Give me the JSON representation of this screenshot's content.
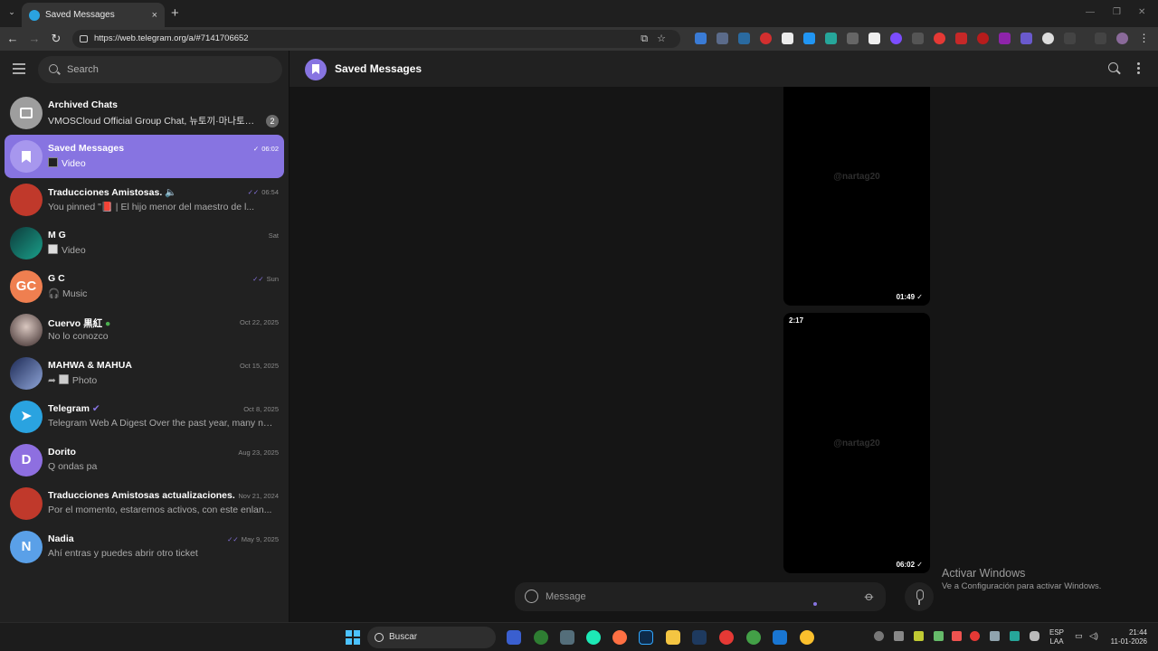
{
  "browser": {
    "tab_title": "Saved Messages",
    "tab_close": "×",
    "new_tab": "+",
    "url": "https://web.telegram.org/a/#7141706652"
  },
  "sidebar": {
    "search_placeholder": "Search",
    "chats": [
      {
        "name": "Archived Chats",
        "preview": "VMOSCloud Official Group Chat, 뉴토끼·마나토끼...",
        "time": "",
        "badge": "2",
        "avatar_text": "",
        "avatar_color": "#9e9e9e"
      },
      {
        "name": "Saved Messages",
        "preview": "Video",
        "time": "06:02",
        "avatar_text": "",
        "avatar_color": "#ffffff"
      },
      {
        "name": "Traducciones Amistosas.",
        "preview_prefix": "You:",
        "preview": "You pinned \"📕 | El hijo menor del maestro de l...",
        "time": "06:54",
        "avatar_text": "",
        "avatar_color": "#c0392b"
      },
      {
        "name": "M G",
        "preview": "Video",
        "time": "Sat",
        "avatar_text": "",
        "avatar_color": "#1a8a7a"
      },
      {
        "name": "G C",
        "preview": "🎧 Music",
        "time": "Sun",
        "avatar_text": "GC",
        "avatar_color": "#ef7f50"
      },
      {
        "name": "Cuervo 黒紅",
        "preview": "No lo conozco",
        "time": "Oct 22, 2025",
        "avatar_text": "",
        "avatar_color": "#5a4a4a"
      },
      {
        "name": "MAHWA & MAHUA",
        "preview": "Photo",
        "time": "Oct 15, 2025",
        "avatar_text": "",
        "avatar_color": "#3b4a7a"
      },
      {
        "name": "Telegram",
        "preview": "Telegram Web A Digest Over the past year, many ne...",
        "time": "Oct 8, 2025",
        "avatar_text": "",
        "avatar_color": "#2aa3e0"
      },
      {
        "name": "Dorito",
        "preview": "Q ondas pa",
        "time": "Aug 23, 2025",
        "avatar_text": "D",
        "avatar_color": "#8e6fe0"
      },
      {
        "name": "Traducciones Amistosas actualizaciones.",
        "preview": "Por el momento, estaremos activos, con este enlan...",
        "time": "Nov 21, 2024",
        "avatar_text": "",
        "avatar_color": "#c0392b"
      },
      {
        "name": "Nadia",
        "preview": "Ahí entras y puedes abrir otro ticket",
        "time": "May 9, 2025",
        "avatar_text": "N",
        "avatar_color": "#5aa0e8"
      }
    ]
  },
  "main": {
    "title": "Saved Messages",
    "videos": [
      {
        "watermark": "@nartag20",
        "time": "01:49 ✓",
        "duration": ""
      },
      {
        "watermark": "@nartag20",
        "time": "06:02 ✓",
        "duration": "2:17"
      }
    ],
    "message_placeholder": "Message"
  },
  "watermark": {
    "title": "Activar Windows",
    "subtitle": "Ve a Configuración para activar Windows."
  },
  "taskbar": {
    "search": "Buscar",
    "lang_1": "ESP",
    "lang_2": "LAA",
    "time": "21:44",
    "date": "11-01-2026"
  }
}
